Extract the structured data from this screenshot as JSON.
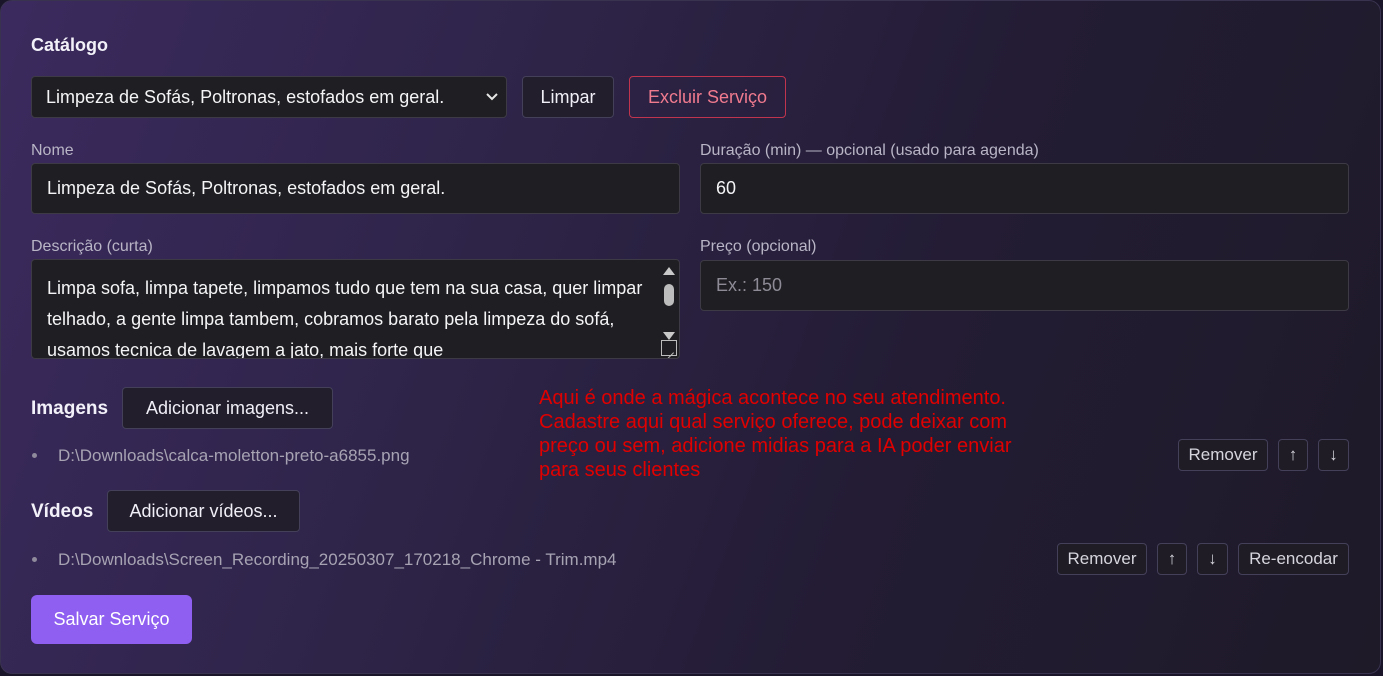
{
  "catalog": {
    "title": "Catálogo",
    "selected_service": "Limpeza de Sofás, Poltronas, estofados em geral.",
    "clear_label": "Limpar",
    "delete_label": "Excluir Serviço"
  },
  "form": {
    "name_label": "Nome",
    "name_value": "Limpeza de Sofás, Poltronas, estofados em geral.",
    "duration_label": "Duração (min) — opcional (usado para agenda)",
    "duration_value": "60",
    "description_label": "Descrição (curta)",
    "description_value": "Limpa sofa, limpa tapete, limpamos tudo que tem na sua casa, quer limpar telhado, a gente limpa tambem, cobramos barato pela limpeza do sofá, usamos tecnica de lavagem a jato, mais forte que",
    "price_label": "Preço (opcional)",
    "price_placeholder": "Ex.: 150"
  },
  "images": {
    "label": "Imagens",
    "add_label": "Adicionar imagens...",
    "files": [
      {
        "path": "D:\\Downloads\\calca-moletton-preto-a6855.png",
        "remove_label": "Remover",
        "up_label": "↑",
        "down_label": "↓"
      }
    ]
  },
  "videos": {
    "label": "Vídeos",
    "add_label": "Adicionar vídeos...",
    "files": [
      {
        "path": "D:\\Downloads\\Screen_Recording_20250307_170218_Chrome - Trim.mp4",
        "remove_label": "Remover",
        "up_label": "↑",
        "down_label": "↓",
        "reencode_label": "Re-encodar"
      }
    ]
  },
  "annotation": "Aqui é onde a mágica acontece no seu atendimento. Cadastre aqui qual serviço oferece, pode deixar com preço ou sem, adicione midias para a IA poder enviar para seus clientes",
  "save_label": "Salvar Serviço",
  "colors": {
    "accent": "#8e5ff0",
    "danger": "#c0344e",
    "annotation": "#e00000"
  }
}
